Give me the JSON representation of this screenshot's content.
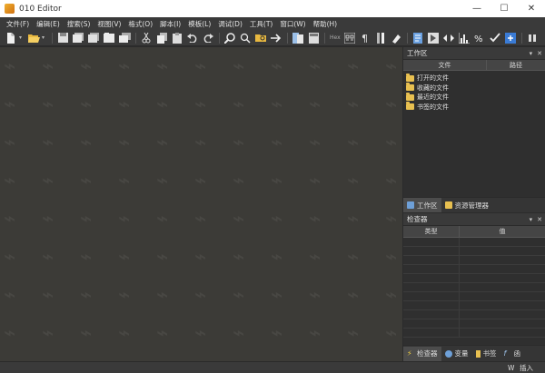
{
  "window": {
    "title": "010 Editor",
    "controls": [
      "—",
      "☐",
      "✕"
    ]
  },
  "menu": [
    "文件(F)",
    "编辑(E)",
    "搜索(S)",
    "视图(V)",
    "格式(O)",
    "脚本(I)",
    "模板(L)",
    "调试(D)",
    "工具(T)",
    "窗口(W)",
    "帮助(H)"
  ],
  "toolbar": {
    "hex_label": "Hex",
    "groups": [
      [
        "new-file-icon",
        "open-folder-icon"
      ],
      [
        "save-icon",
        "save-as-icon",
        "save-all-icon",
        "close-file-icon",
        "close-all-icon"
      ],
      [
        "cut-icon",
        "copy-icon",
        "paste-icon",
        "undo-icon",
        "redo-icon"
      ],
      [
        "find-icon",
        "find-replace-icon",
        "find-in-files-icon",
        "goto-icon"
      ],
      [
        "compare-icon",
        "calculator-icon"
      ],
      [
        "hex-mode-icon",
        "show-whitespace-icon",
        "column-mode-icon",
        "highlight-icon"
      ],
      [
        "template-icon",
        "run-template-icon",
        "run-script-icon",
        "histogram-icon",
        "base-converter-icon",
        "checksum-icon",
        "import-icon"
      ],
      [
        "pause-icon"
      ]
    ]
  },
  "workspace": {
    "title": "工作区",
    "columns": [
      "文件",
      "路径"
    ],
    "items": [
      "打开的文件",
      "收藏的文件",
      "最近的文件",
      "书签的文件"
    ]
  },
  "left_tabs": [
    "工作区",
    "资源管理器"
  ],
  "inspector": {
    "title": "检查器",
    "columns": [
      "类型",
      "值"
    ]
  },
  "bottom_tabs": [
    "检查器",
    "变量",
    "书签",
    "函"
  ],
  "status": {
    "mode": "W",
    "insert": "插入"
  },
  "colors": {
    "editor_bg": "#3c3b37",
    "panel_bg": "#2f2f2f",
    "folder": "#e8c050"
  }
}
